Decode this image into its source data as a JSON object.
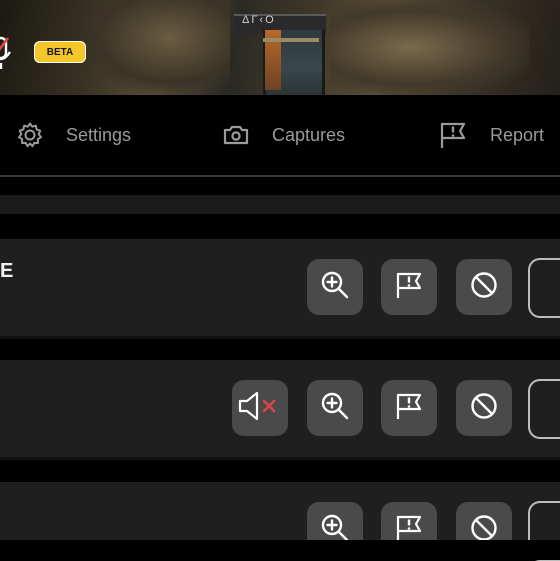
{
  "banner": {
    "sign_text": "ΔΓ‹Ο",
    "beta_badge": "BETA",
    "icons": [
      "microphone-muted-icon"
    ]
  },
  "nav": {
    "items": [
      {
        "label": "Settings",
        "icon": "gear-icon"
      },
      {
        "label": "Captures",
        "icon": "camera-icon"
      },
      {
        "label": "Report",
        "icon": "flag-alert-icon"
      }
    ]
  },
  "list": {
    "rows": [
      {
        "title": "E",
        "actions": [
          "zoom-in-icon",
          "report-flag-icon",
          "block-icon"
        ]
      },
      {
        "title": "",
        "actions": [
          "speaker-muted-icon",
          "zoom-in-icon",
          "report-flag-icon",
          "block-icon"
        ]
      },
      {
        "title": "",
        "actions": [
          "zoom-in-icon",
          "report-flag-icon",
          "block-icon"
        ]
      }
    ]
  },
  "colors": {
    "beta_badge": "#f5c62b",
    "mute_x": "#e0444a",
    "button_bg": "#4a4a4a",
    "row_bg": "#1f1f1f"
  }
}
